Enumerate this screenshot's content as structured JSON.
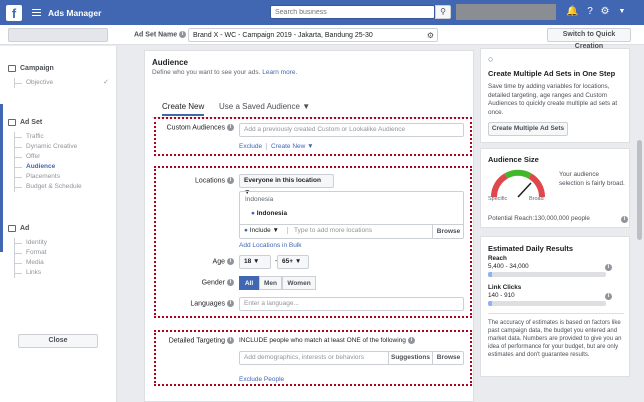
{
  "topbar": {
    "logo": "f",
    "app_title": "Ads Manager",
    "search_placeholder": "Search business"
  },
  "subheader": {
    "ad_set_name_label": "Ad Set Name",
    "ad_set_name_value": "Brand X - WC - Campaign 2019 - Jakarta, Bandung 25-30",
    "quick_creation_button": "Switch to Quick Creation"
  },
  "sidebar": {
    "campaign": {
      "label": "Campaign",
      "items": [
        "Objective"
      ]
    },
    "adset": {
      "label": "Ad Set",
      "items": [
        "Traffic",
        "Dynamic Creative",
        "Offer",
        "Audience",
        "Placements",
        "Budget & Schedule"
      ],
      "active": "Audience"
    },
    "ad": {
      "label": "Ad",
      "items": [
        "Identity",
        "Format",
        "Media",
        "Links"
      ]
    },
    "close_button": "Close"
  },
  "audience": {
    "title": "Audience",
    "subtitle": "Define who you want to see your ads.",
    "learn_more": "Learn more.",
    "tabs": [
      "Create New",
      "Use a Saved Audience"
    ],
    "custom_audiences": {
      "label": "Custom Audiences",
      "placeholder": "Add a previously created Custom or Lookalike Audience",
      "exclude": "Exclude",
      "create_new": "Create New"
    },
    "locations": {
      "label": "Locations",
      "dropdown": "Everyone in this location",
      "group": "Indonesia",
      "item": "Indonesia",
      "include": "Include",
      "placeholder": "Type to add more locations",
      "browse": "Browse",
      "bulk": "Add Locations in Bulk"
    },
    "age": {
      "label": "Age",
      "min": "18",
      "max": "65+",
      "separator": "-"
    },
    "gender": {
      "label": "Gender",
      "options": [
        "All",
        "Men",
        "Women"
      ],
      "selected": "All"
    },
    "languages": {
      "label": "Languages",
      "placeholder": "Enter a language..."
    },
    "detailed_targeting": {
      "label": "Detailed Targeting",
      "include_text": "INCLUDE people who match at least ONE of the following",
      "placeholder": "Add demographics, interests or behaviors",
      "suggestions": "Suggestions",
      "browse": "Browse",
      "exclude": "Exclude People"
    }
  },
  "right_panel": {
    "tip": {
      "title": "Create Multiple Ad Sets in One Step",
      "text": "Save time by adding variables for locations, detailed targeting, age ranges and Custom Audiences to quickly create multiple ad sets at once.",
      "button": "Create Multiple Ad Sets"
    },
    "audience_size": {
      "title": "Audience Size",
      "gauge_left": "Specific",
      "gauge_right": "Broad",
      "description": "Your audience selection is fairly broad.",
      "potential_reach": "Potential Reach:130,000,000 people"
    },
    "daily_results": {
      "title": "Estimated Daily Results",
      "reach_label": "Reach",
      "reach_value": "5,400 - 34,000",
      "reach_fraction": 0.03,
      "clicks_label": "Link Clicks",
      "clicks_value": "140 - 910",
      "clicks_fraction": 0.03,
      "note": "The accuracy of estimates is based on factors like past campaign data, the budget you entered and market data. Numbers are provided to give you an idea of performance for your budget, but are only estimates and don't guarantee results."
    }
  }
}
